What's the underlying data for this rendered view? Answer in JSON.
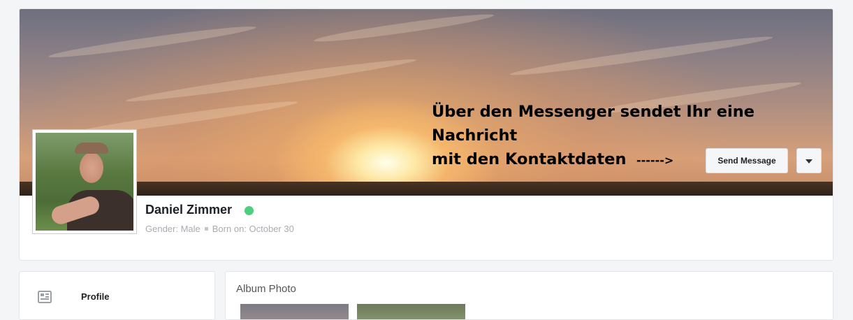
{
  "cover": {
    "annotation_line1": "Über den Messenger sendet Ihr eine Nachricht",
    "annotation_line2": "mit den Kontaktdaten",
    "arrow": "------>"
  },
  "actions": {
    "send_message_label": "Send Message",
    "more_icon": "caret-down-icon"
  },
  "profile": {
    "name": "Daniel Zimmer",
    "status": "online",
    "gender": "Gender: Male",
    "born": "Born on: October 30"
  },
  "sidebar": {
    "items": [
      {
        "icon": "profile-card-icon",
        "label": "Profile"
      }
    ]
  },
  "album": {
    "title": "Album Photo"
  },
  "colors": {
    "online": "#4cd07d",
    "border": "#e3e5e8"
  }
}
